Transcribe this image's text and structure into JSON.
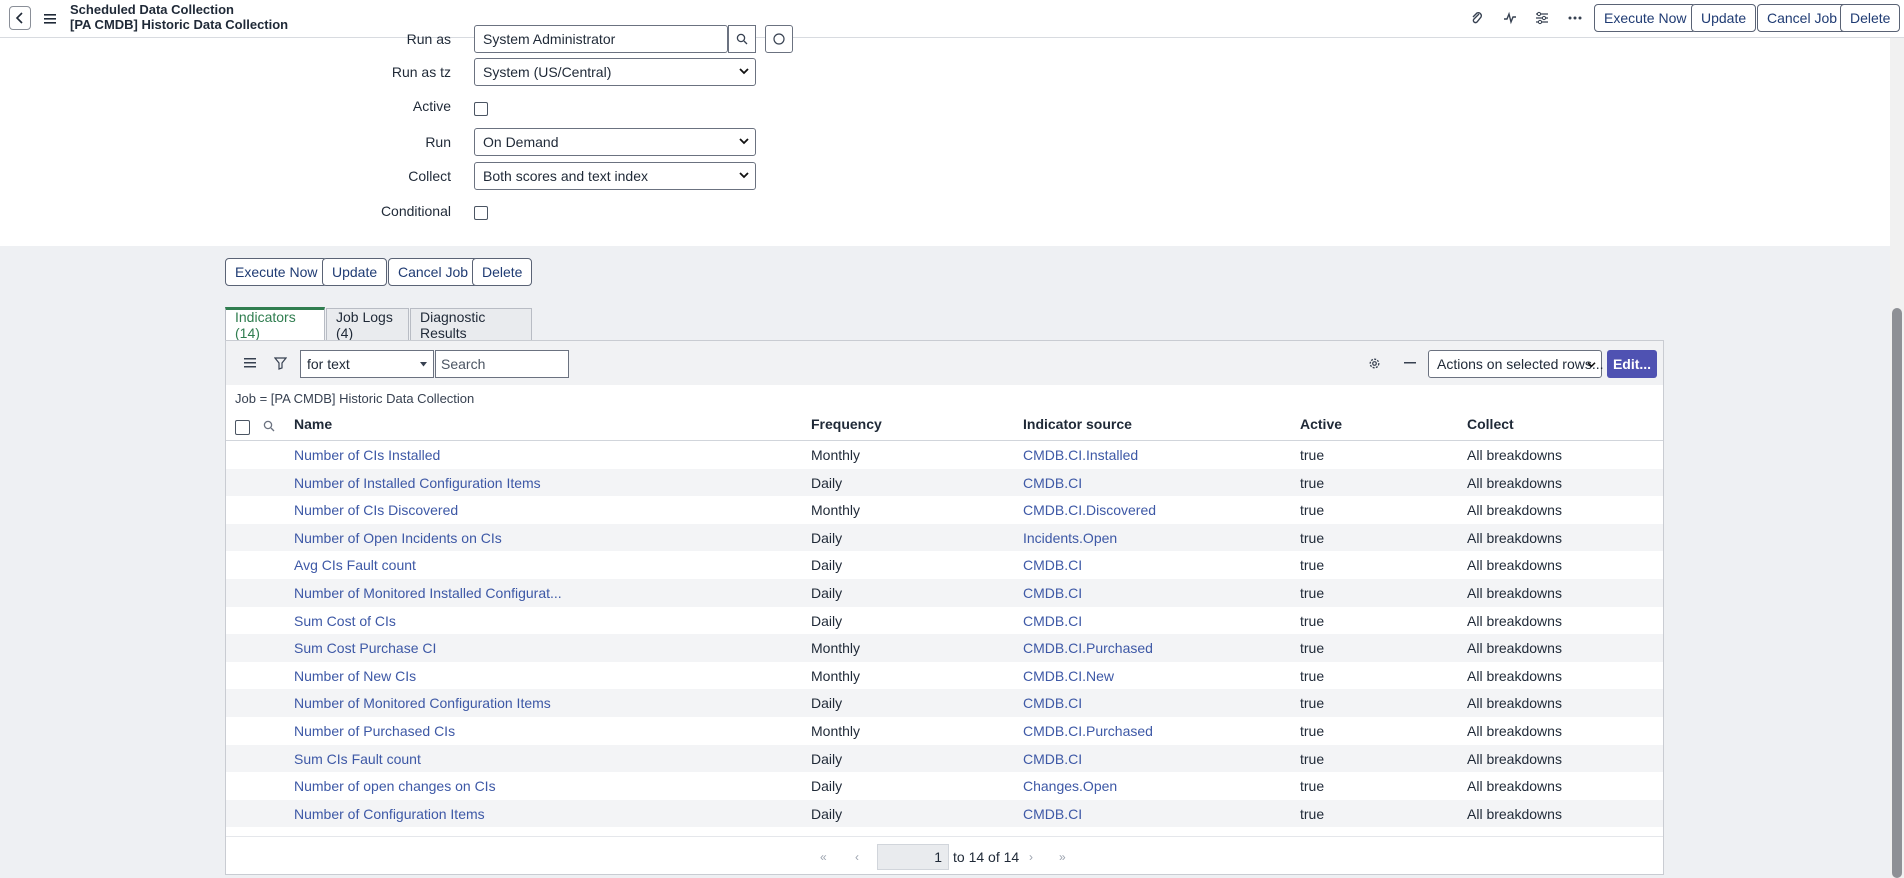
{
  "header": {
    "title_line1": "Scheduled Data Collection",
    "title_line2": "[PA CMDB] Historic Data Collection",
    "buttons": {
      "execute_now": "Execute Now",
      "update": "Update",
      "cancel_job": "Cancel Job",
      "delete": "Delete"
    },
    "icons": [
      "paperclip-icon",
      "activity-icon",
      "sliders-icon",
      "more-icon"
    ]
  },
  "form": {
    "run_as": {
      "label": "Run as",
      "value": "System Administrator"
    },
    "run_as_tz": {
      "label": "Run as tz",
      "value": "System (US/Central)"
    },
    "active": {
      "label": "Active",
      "checked": false
    },
    "run": {
      "label": "Run",
      "value": "On Demand"
    },
    "collect": {
      "label": "Collect",
      "value": "Both scores and text index"
    },
    "conditional": {
      "label": "Conditional",
      "checked": false
    }
  },
  "form_buttons": {
    "execute_now": "Execute Now",
    "update": "Update",
    "cancel_job": "Cancel Job",
    "delete": "Delete"
  },
  "tabs": [
    {
      "label": "Indicators (14)",
      "active": true
    },
    {
      "label": "Job Logs (4)",
      "active": false
    },
    {
      "label": "Diagnostic Results",
      "active": false
    }
  ],
  "list": {
    "search_field_select": "for text",
    "search_placeholder": "Search",
    "actions_select": "Actions on selected rows...",
    "edit_button": "Edit...",
    "breadcrumb": "Job = [PA CMDB] Historic Data Collection",
    "columns": [
      "Name",
      "Frequency",
      "Indicator source",
      "Active",
      "Collect"
    ],
    "rows": [
      {
        "name": "Number of CIs Installed",
        "frequency": "Monthly",
        "source": "CMDB.CI.Installed",
        "active": "true",
        "collect": "All breakdowns"
      },
      {
        "name": "Number of Installed Configuration Items",
        "frequency": "Daily",
        "source": "CMDB.CI",
        "active": "true",
        "collect": "All breakdowns"
      },
      {
        "name": "Number of CIs Discovered",
        "frequency": "Monthly",
        "source": "CMDB.CI.Discovered",
        "active": "true",
        "collect": "All breakdowns"
      },
      {
        "name": "Number of Open Incidents on CIs",
        "frequency": "Daily",
        "source": "Incidents.Open",
        "active": "true",
        "collect": "All breakdowns"
      },
      {
        "name": "Avg CIs Fault count",
        "frequency": "Daily",
        "source": "CMDB.CI",
        "active": "true",
        "collect": "All breakdowns"
      },
      {
        "name": "Number of Monitored Installed Configurat...",
        "frequency": "Daily",
        "source": "CMDB.CI",
        "active": "true",
        "collect": "All breakdowns"
      },
      {
        "name": "Sum Cost of CIs",
        "frequency": "Daily",
        "source": "CMDB.CI",
        "active": "true",
        "collect": "All breakdowns"
      },
      {
        "name": "Sum Cost Purchase CI",
        "frequency": "Monthly",
        "source": "CMDB.CI.Purchased",
        "active": "true",
        "collect": "All breakdowns"
      },
      {
        "name": "Number of New CIs",
        "frequency": "Monthly",
        "source": "CMDB.CI.New",
        "active": "true",
        "collect": "All breakdowns"
      },
      {
        "name": "Number of Monitored Configuration Items",
        "frequency": "Daily",
        "source": "CMDB.CI",
        "active": "true",
        "collect": "All breakdowns"
      },
      {
        "name": "Number of Purchased CIs",
        "frequency": "Monthly",
        "source": "CMDB.CI.Purchased",
        "active": "true",
        "collect": "All breakdowns"
      },
      {
        "name": "Sum CIs Fault count",
        "frequency": "Daily",
        "source": "CMDB.CI",
        "active": "true",
        "collect": "All breakdowns"
      },
      {
        "name": "Number of open changes on CIs",
        "frequency": "Daily",
        "source": "Changes.Open",
        "active": "true",
        "collect": "All breakdowns"
      },
      {
        "name": "Number of Configuration Items",
        "frequency": "Daily",
        "source": "CMDB.CI",
        "active": "true",
        "collect": "All breakdowns"
      }
    ],
    "pager": {
      "page": "1",
      "text": "to 14 of 14"
    }
  },
  "colors": {
    "accent": "#4f52b2",
    "link": "#3d58a6",
    "active_tab": "#2f7d4f"
  }
}
